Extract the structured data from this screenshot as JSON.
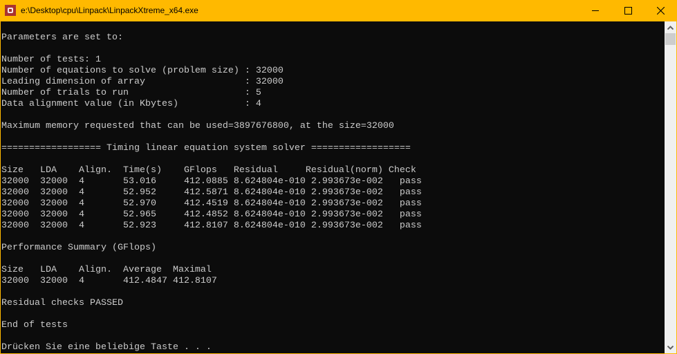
{
  "window": {
    "title": "e:\\Desktop\\cpu\\Linpack\\LinpackXtreme_x64.exe",
    "minimize": "minimize",
    "maximize": "maximize",
    "close": "close"
  },
  "console": {
    "lines": [
      "",
      "Parameters are set to:",
      "",
      "Number of tests: 1",
      "Number of equations to solve (problem size) : 32000",
      "Leading dimension of array                  : 32000",
      "Number of trials to run                     : 5",
      "Data alignment value (in Kbytes)            : 4",
      "",
      "Maximum memory requested that can be used=3897676800, at the size=32000",
      "",
      "================== Timing linear equation system solver ==================",
      "",
      "Size   LDA    Align.  Time(s)    GFlops   Residual     Residual(norm) Check",
      "32000  32000  4       53.016     412.0885 8.624804e-010 2.993673e-002   pass",
      "32000  32000  4       52.952     412.5871 8.624804e-010 2.993673e-002   pass",
      "32000  32000  4       52.970     412.4519 8.624804e-010 2.993673e-002   pass",
      "32000  32000  4       52.965     412.4852 8.624804e-010 2.993673e-002   pass",
      "32000  32000  4       52.923     412.8107 8.624804e-010 2.993673e-002   pass",
      "",
      "Performance Summary (GFlops)",
      "",
      "Size   LDA    Align.  Average  Maximal",
      "32000  32000  4       412.4847 412.8107",
      "",
      "Residual checks PASSED",
      "",
      "End of tests",
      "",
      "Drücken Sie eine beliebige Taste . . ."
    ]
  }
}
